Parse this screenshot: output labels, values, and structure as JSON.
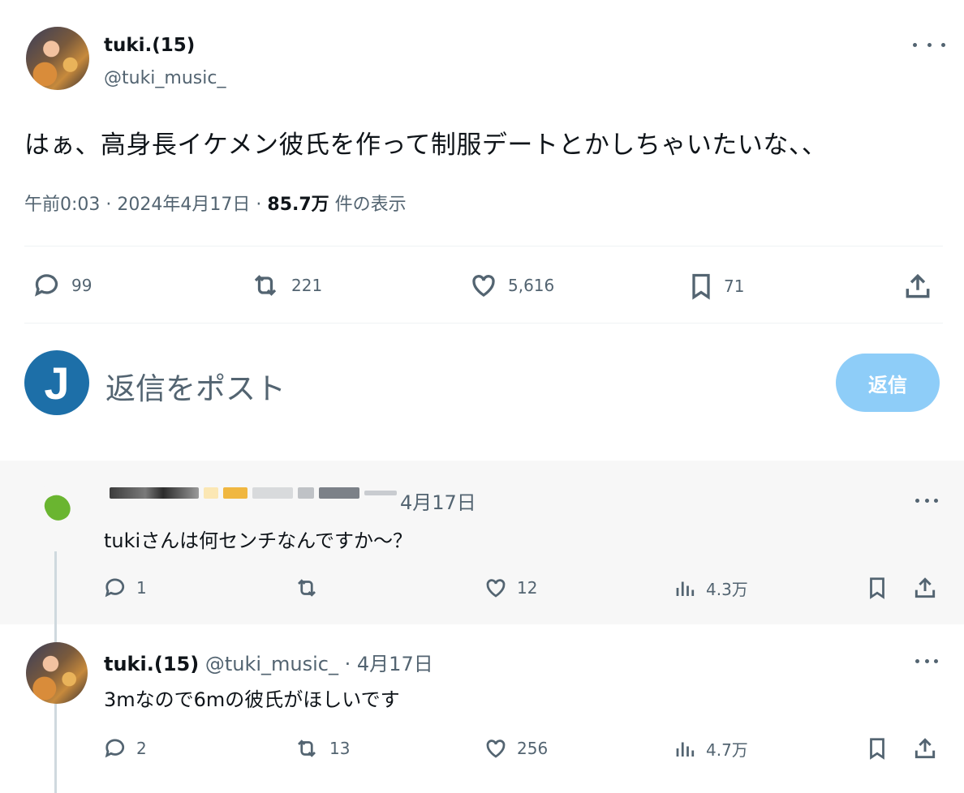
{
  "tweet": {
    "author_name": "tuki.(15)",
    "author_handle": "@tuki_music_",
    "text": "はぁ、高身長イケメン彼氏を作って制服デートとかしちゃいたいな、、",
    "time": "午前0:03",
    "date": "2024年4月17日",
    "views_count": "85.7万",
    "views_label": "件の表示",
    "replies": "99",
    "reposts": "221",
    "likes": "5,616",
    "bookmarks": "71"
  },
  "compose": {
    "avatar_letter": "J",
    "placeholder": "返信をポスト",
    "button_label": "返信"
  },
  "replies": [
    {
      "date": "4月17日",
      "text": "tukiさんは何センチなんですか～？",
      "replies": "1",
      "reposts": "",
      "likes": "12",
      "views": "4.3万"
    },
    {
      "author_name": "tuki.(15)",
      "author_handle": "@tuki_music_",
      "date": "4月17日",
      "text": "3mなので6mの彼氏がほしいです",
      "replies": "2",
      "reposts": "13",
      "likes": "256",
      "views": "4.7万"
    }
  ],
  "colors": {
    "text": "#0f1419",
    "secondary": "#536471",
    "reply_button": "#8ecdf8",
    "compose_avatar": "#1d6fa8"
  }
}
